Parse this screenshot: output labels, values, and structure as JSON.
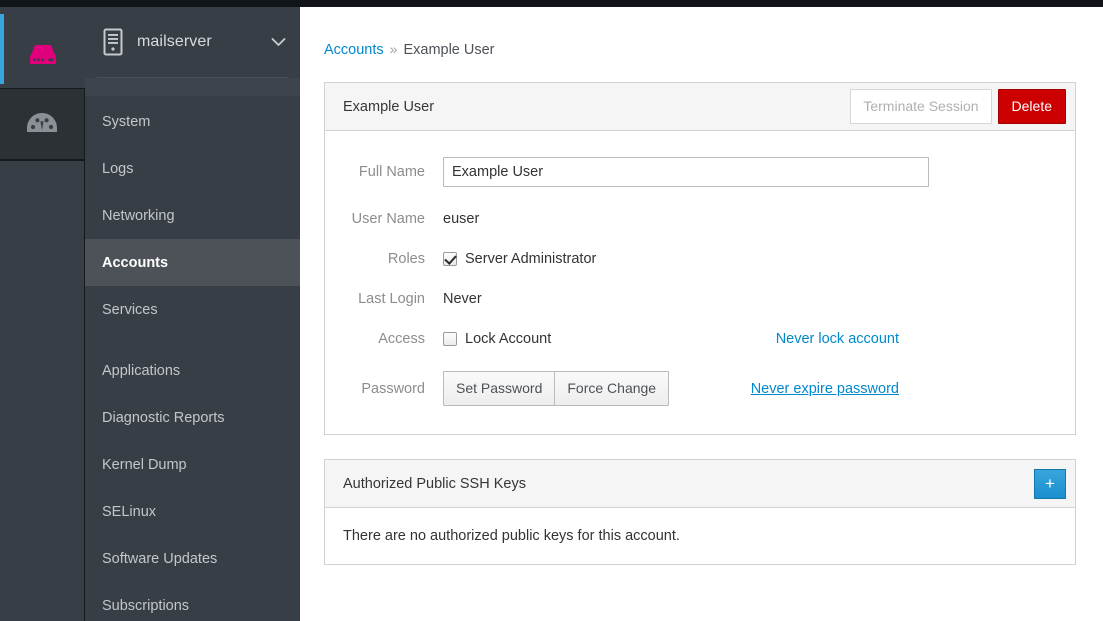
{
  "colors": {
    "accent_blue": "#39a5dc",
    "link_blue": "#0088ce",
    "danger_red": "#c00000",
    "sidebar_bg": "#383e45",
    "sidebar_active": "#4d5258",
    "logo_magenta": "#e0007d",
    "topbar": "#111418"
  },
  "rail": {
    "logo_icon": "storage-server-icon",
    "items": [
      {
        "icon": "dashboard-gauge-icon",
        "selected": true
      }
    ]
  },
  "sidebar": {
    "host_icon": "server-tower-icon",
    "host_name": "mailserver",
    "host_dropdown_icon": "chevron-down-icon",
    "groups": [
      {
        "items": [
          {
            "label": "System",
            "active": false
          },
          {
            "label": "Logs",
            "active": false
          },
          {
            "label": "Networking",
            "active": false
          },
          {
            "label": "Accounts",
            "active": true
          },
          {
            "label": "Services",
            "active": false
          }
        ]
      },
      {
        "items": [
          {
            "label": "Applications",
            "active": false
          },
          {
            "label": "Diagnostic Reports",
            "active": false
          },
          {
            "label": "Kernel Dump",
            "active": false
          },
          {
            "label": "SELinux",
            "active": false
          },
          {
            "label": "Software Updates",
            "active": false
          },
          {
            "label": "Subscriptions",
            "active": false
          }
        ]
      }
    ]
  },
  "breadcrumb": {
    "root_label": "Accounts",
    "separator": "»",
    "current_label": "Example User"
  },
  "account_panel": {
    "title": "Example User",
    "terminate_label": "Terminate Session",
    "terminate_disabled": true,
    "delete_label": "Delete",
    "fields": {
      "full_name": {
        "label": "Full Name",
        "value": "Example User",
        "placeholder": ""
      },
      "user_name": {
        "label": "User Name",
        "value": "euser"
      },
      "roles": {
        "label": "Roles",
        "checkbox_label": "Server Administrator",
        "checked": true
      },
      "last_login": {
        "label": "Last Login",
        "value": "Never"
      },
      "access": {
        "label": "Access",
        "checkbox_label": "Lock Account",
        "checked": false,
        "link_label": "Never lock account",
        "link_underlined": false
      },
      "password": {
        "label": "Password",
        "set_password_label": "Set Password",
        "force_change_label": "Force Change",
        "link_label": "Never expire password",
        "link_underlined": true
      }
    }
  },
  "ssh_panel": {
    "title": "Authorized Public SSH Keys",
    "add_button_icon": "plus-icon",
    "add_button_label": "+",
    "empty_message": "There are no authorized public keys for this account."
  }
}
